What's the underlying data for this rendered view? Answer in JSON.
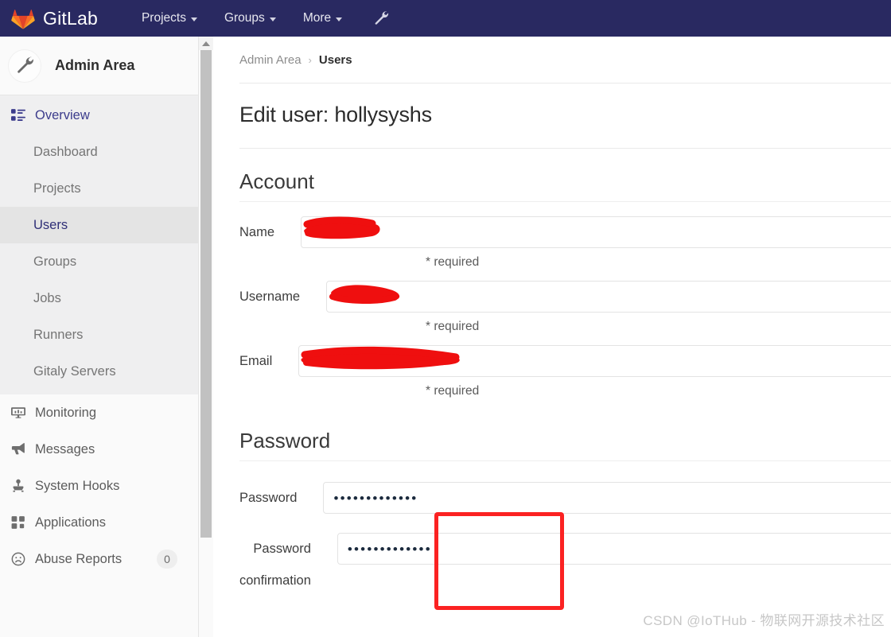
{
  "navbar": {
    "brand": "GitLab",
    "logo_icon": "gitlab-fox-logo",
    "links": [
      {
        "label": "Projects",
        "icon": "chevron-down-icon"
      },
      {
        "label": "Groups",
        "icon": "chevron-down-icon"
      },
      {
        "label": "More",
        "icon": "chevron-down-icon"
      }
    ],
    "admin_icon": "wrench-icon",
    "background_color": "#292961"
  },
  "sidebar": {
    "header": {
      "title": "Admin Area",
      "icon": "wrench-icon"
    },
    "overview": {
      "label": "Overview",
      "icon": "grid-list-icon"
    },
    "sub_items": [
      {
        "label": "Dashboard",
        "active": false
      },
      {
        "label": "Projects",
        "active": false
      },
      {
        "label": "Users",
        "active": true
      },
      {
        "label": "Groups",
        "active": false
      },
      {
        "label": "Jobs",
        "active": false
      },
      {
        "label": "Runners",
        "active": false
      },
      {
        "label": "Gitaly Servers",
        "active": false
      }
    ],
    "items": [
      {
        "label": "Monitoring",
        "icon": "monitor-icon",
        "badge": ""
      },
      {
        "label": "Messages",
        "icon": "megaphone-icon",
        "badge": ""
      },
      {
        "label": "System Hooks",
        "icon": "hook-icon",
        "badge": ""
      },
      {
        "label": "Applications",
        "icon": "apps-grid-icon",
        "badge": ""
      },
      {
        "label": "Abuse Reports",
        "icon": "frown-face-icon",
        "badge": "0"
      }
    ],
    "scrollbar": {
      "up_arrow_icon": "chevron-up-icon"
    }
  },
  "breadcrumb": {
    "parent": "Admin Area",
    "separator": "›",
    "current": "Users"
  },
  "page": {
    "title": "Edit user: hollysyshs"
  },
  "account": {
    "heading": "Account",
    "fields": [
      {
        "label": "Name",
        "value": "",
        "redacted": true,
        "hint": "* required"
      },
      {
        "label": "Username",
        "value": "",
        "redacted": true,
        "hint": "* required"
      },
      {
        "label": "Email",
        "value": "",
        "redacted": true,
        "hint": "* required"
      }
    ]
  },
  "password": {
    "heading": "Password",
    "fields": [
      {
        "label": "Password",
        "value": "•••••••••••••"
      },
      {
        "label": "Password confirmation",
        "value": "•••••••••••••"
      }
    ],
    "highlight_color": "#fb2222"
  },
  "watermark": {
    "text": "CSDN @IoTHub - 物联网开源技术社区"
  }
}
